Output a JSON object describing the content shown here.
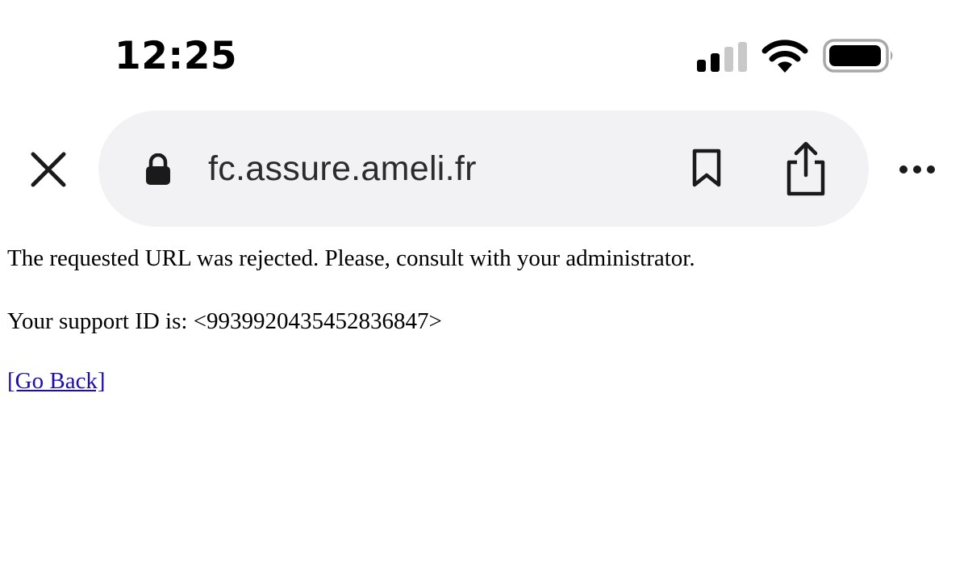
{
  "status_bar": {
    "time": "12:25",
    "icons": [
      "signal-icon",
      "wifi-icon",
      "battery-icon"
    ]
  },
  "browser": {
    "url": "fc.assure.ameli.fr",
    "icons": {
      "close": "close-icon",
      "lock": "lock-icon",
      "bookmark": "bookmark-icon",
      "share": "share-icon",
      "more": "more-icon"
    },
    "url_bar_color": "#f2f2f4"
  },
  "page": {
    "message": "The requested URL was rejected. Please, consult with your administrator.",
    "support_label": "Your support ID is: <9939920435452836847>",
    "go_back_label": "[Go Back]",
    "link_color": "#1a0dab"
  }
}
